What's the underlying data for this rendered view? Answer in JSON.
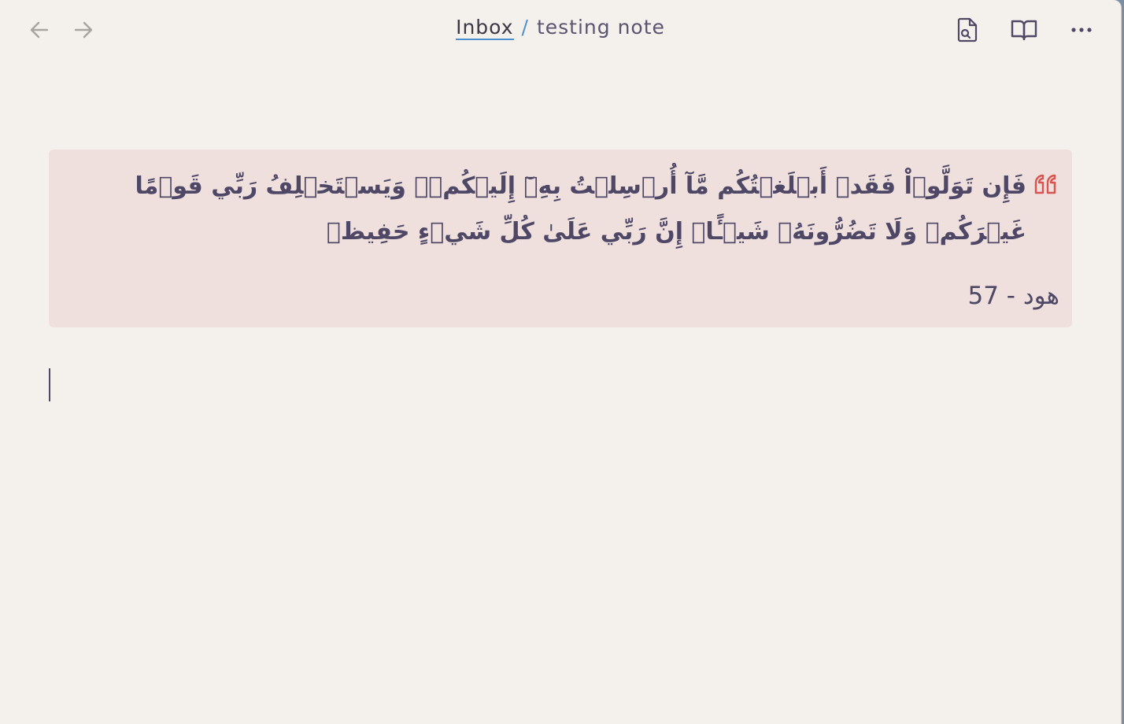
{
  "topbar": {
    "back_icon": "arrow-left-icon",
    "forward_icon": "arrow-right-icon",
    "breadcrumb": {
      "folder": "Inbox",
      "separator": "/",
      "note": "testing note"
    },
    "actions": [
      {
        "name": "search-file-icon"
      },
      {
        "name": "reading-view-icon"
      },
      {
        "name": "more-options-icon"
      }
    ]
  },
  "callout": {
    "icon": "quote-icon",
    "verse": "فَإِن تَوَلَّوۡاْ فَقَدۡ أَبۡلَغۡتُكُم مَّآ أُرۡسِلۡتُ بِهِۦٓ إِلَيۡكُمۡۚ وَيَسۡتَخۡلِفُ رَبِّي قَوۡمًا غَيۡرَكُمۡ وَلَا تَضُرُّونَهُۥ شَيۡـًٔاۚ إِنَّ رَبِّي عَلَىٰ كُلِّ شَيۡءٍ حَفِيظٞ",
    "reference": "هود - 57"
  },
  "colors": {
    "background": "#f4f1ec",
    "callout_background": "#efe0de",
    "accent": "#4b8fcf",
    "quote_icon": "#d9534f",
    "text": "#4e4866"
  }
}
